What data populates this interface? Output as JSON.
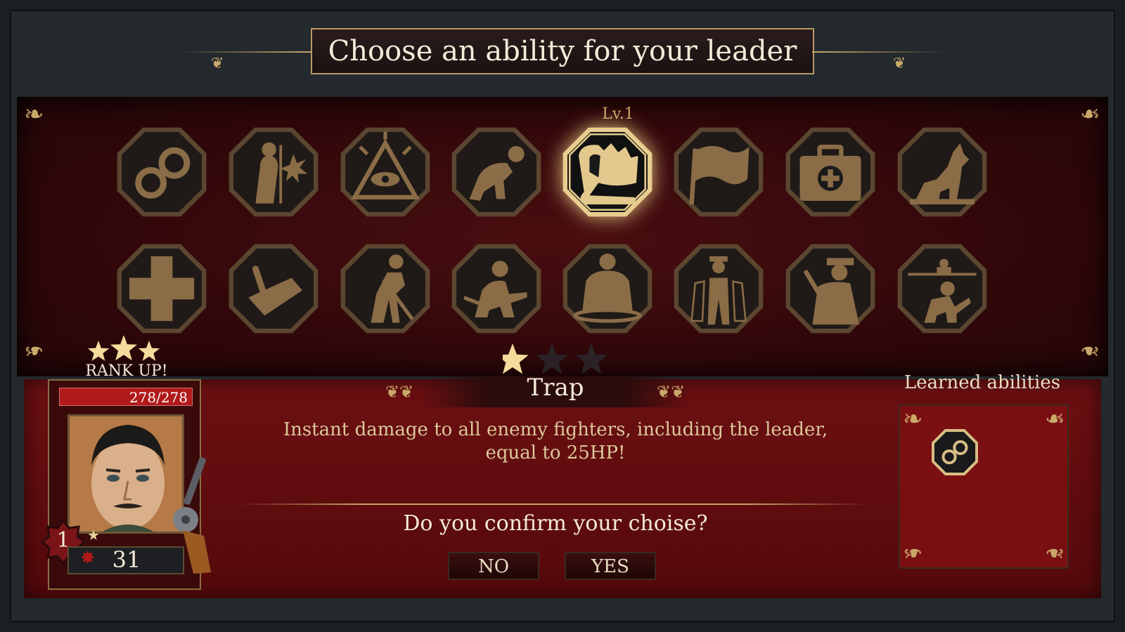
{
  "header": {
    "title": "Choose an ability for your leader"
  },
  "abilities": {
    "selected_level_label": "Lv.1",
    "row1": [
      {
        "icon": "handcuffs-icon",
        "selected": false
      },
      {
        "icon": "explosion-man-icon",
        "selected": false
      },
      {
        "icon": "all-seeing-eye-icon",
        "selected": false
      },
      {
        "icon": "kneeling-man-icon",
        "selected": false
      },
      {
        "icon": "bear-trap-icon",
        "selected": true
      },
      {
        "icon": "flag-icon",
        "selected": false
      },
      {
        "icon": "medkit-icon",
        "selected": false
      },
      {
        "icon": "howling-wolf-icon",
        "selected": false
      }
    ],
    "row2": [
      {
        "icon": "medical-cross-icon",
        "selected": false
      },
      {
        "icon": "trowel-icon",
        "selected": false
      },
      {
        "icon": "digging-man-icon",
        "selected": false
      },
      {
        "icon": "crouching-shooter-icon",
        "selected": false
      },
      {
        "icon": "strongman-icon",
        "selected": false
      },
      {
        "icon": "mobster-group-icon",
        "selected": false
      },
      {
        "icon": "gangster-tommy-gun-icon",
        "selected": false
      },
      {
        "icon": "soldiers-icon",
        "selected": false
      }
    ],
    "ability_stars": {
      "filled": 1,
      "total": 3
    }
  },
  "leader": {
    "rank_up_label": "RANK UP!",
    "rank_stars": 3,
    "hp": "278/278",
    "hp_fraction": 1.0,
    "level": "1",
    "power": "31"
  },
  "description": {
    "title": "Trap",
    "text": "Instant damage to all enemy fighters, including the leader, equal to 25HP!",
    "confirm_question": "Do you confirm your choise?",
    "no_label": "NO",
    "yes_label": "YES"
  },
  "learned": {
    "label": "Learned abilities",
    "items": [
      {
        "icon": "handcuffs-icon"
      }
    ]
  },
  "colors": {
    "gold": "#c9a86a",
    "dark_red": "#33080a",
    "panel_red": "#6c1012",
    "icon_fill": "#8a6c47",
    "selected_glow": "#ffe196"
  }
}
